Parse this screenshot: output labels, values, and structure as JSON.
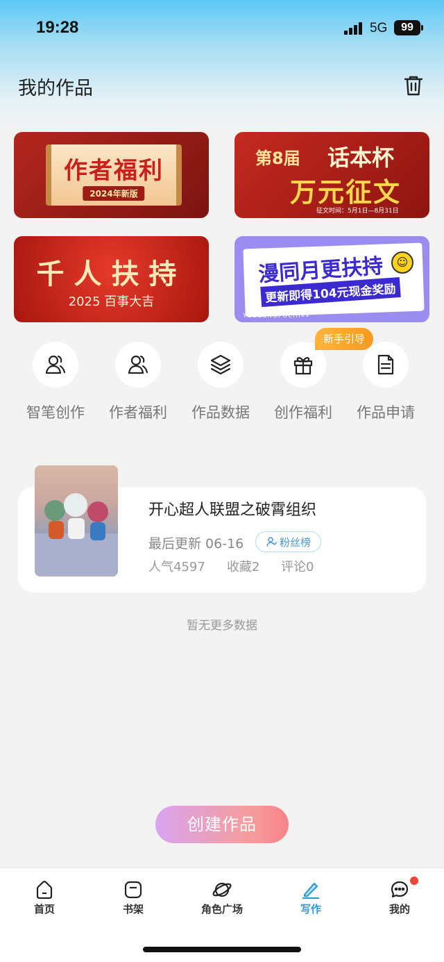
{
  "status": {
    "time": "19:28",
    "network": "5G",
    "battery": "99"
  },
  "header": {
    "title": "我的作品"
  },
  "banners": [
    {
      "title": "作者福利",
      "subtitle": "2024年新版"
    },
    {
      "line1": "第8届",
      "line2": "话本杯",
      "line3": "万元征文",
      "note": "征文时间：5月1日—8月31日"
    },
    {
      "title": "千人扶持",
      "subtitle": "2025 百事大吉"
    },
    {
      "title": "漫同月更扶持",
      "subtitle": "更新即得104元现金奖励",
      "tag": "YUEGENGFUCHI»»"
    }
  ],
  "quick_actions": [
    {
      "label": "智笔创作",
      "icon": "user-pen-icon"
    },
    {
      "label": "作者福利",
      "icon": "users-icon"
    },
    {
      "label": "作品数据",
      "icon": "layers-icon"
    },
    {
      "label": "创作福利",
      "icon": "gift-icon"
    },
    {
      "label": "作品申请",
      "icon": "document-icon"
    }
  ],
  "guide_badge": "新手引导",
  "work": {
    "title": "开心超人联盟之破霄组织",
    "updated": "最后更新 06-16",
    "fans_label": "粉丝榜",
    "popularity": "人气4597",
    "favorites": "收藏2",
    "comments": "评论0"
  },
  "no_more": "暂无更多数据",
  "create_button": "创建作品",
  "tabs": [
    {
      "label": "首页",
      "icon": "home-icon"
    },
    {
      "label": "书架",
      "icon": "bookshelf-icon"
    },
    {
      "label": "角色广场",
      "icon": "planet-icon"
    },
    {
      "label": "写作",
      "icon": "pen-icon",
      "active": true
    },
    {
      "label": "我的",
      "icon": "chat-icon"
    }
  ],
  "colors": {
    "accent": "#2d9ad8",
    "badge": "#f69b1f",
    "notification": "#f04438"
  }
}
